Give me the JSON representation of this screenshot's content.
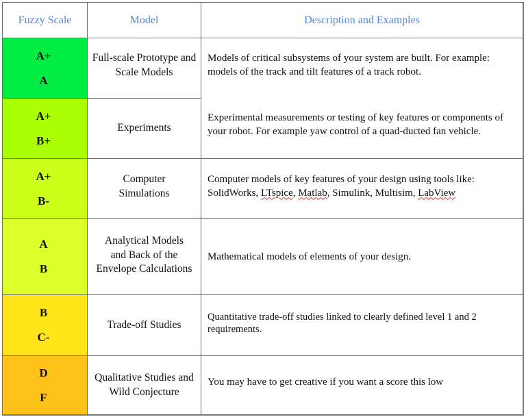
{
  "header": {
    "fuzzy_scale": "Fuzzy Scale",
    "model": "Model",
    "description": "Description and Examples"
  },
  "rows": [
    {
      "grades": [
        "A+",
        "A"
      ],
      "grade_color": "#00ee44",
      "model": "Full-scale Prototype and Scale Models",
      "description": "Models of critical subsystems of your system are built. For example: models of the track and tilt features of a track robot."
    },
    {
      "grades": [
        "A+",
        "B+"
      ],
      "grade_color": "#aaff00",
      "model": "Experiments",
      "description": "Experimental measurements or testing of key features or components of your robot. For example yaw control of a quad-ducted fan vehicle."
    },
    {
      "grades": [
        "A+",
        "B-"
      ],
      "grade_color": "#ccff1a",
      "model": "Computer Simulations",
      "description_prefix": "Computer models of key features of your design using tools like: SolidWorks, ",
      "description_tools": [
        "LTspice",
        "Matlab",
        "Simulink",
        "Multisim",
        "LabView"
      ],
      "description": "Computer models of key features of your design using tools like: SolidWorks, LTspice, Matlab, Simulink, Multisim, LabView"
    },
    {
      "grades": [
        "A",
        "B"
      ],
      "grade_color": "#ddff2a",
      "model": "Analytical Models and Back of the Envelope Calculations",
      "description": "Mathematical models of elements of your design."
    },
    {
      "grades": [
        "B",
        "C-"
      ],
      "grade_color": "#ffe51a",
      "model": "Trade-off Studies",
      "description": "Quantitative trade-off studies linked to clearly defined level 1 and 2 requirements."
    },
    {
      "grades": [
        "D",
        "F"
      ],
      "grade_color": "#ffc21a",
      "model": "Qualitative Studies and Wild Conjecture",
      "description": "You may have to get creative if you want a score this low"
    }
  ],
  "colors": {
    "header_text": "#4a86e8",
    "border": "#6e6e6e",
    "spellcheck_underline": "#dd3333"
  }
}
